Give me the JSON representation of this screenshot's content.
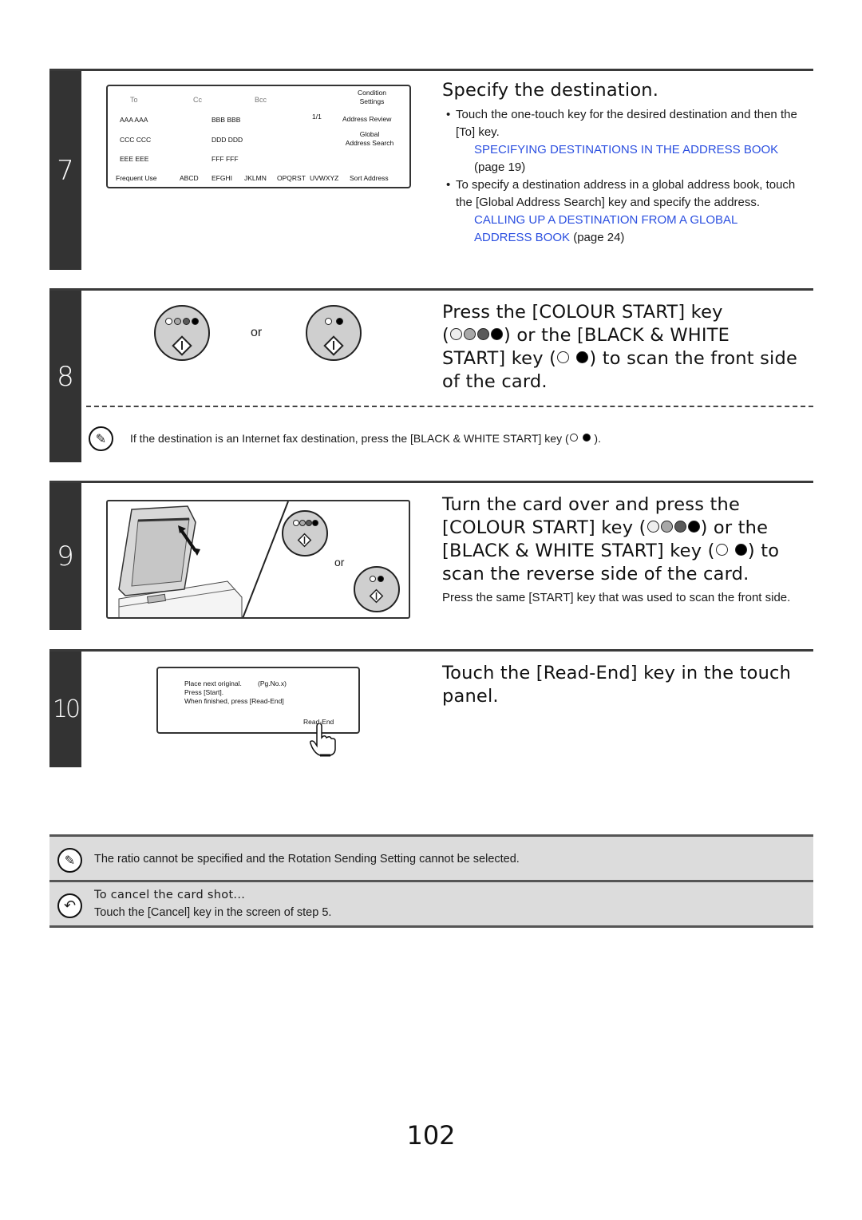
{
  "page_number": "102",
  "steps": [
    {
      "number": "7",
      "title": "Specify the destination.",
      "panel": {
        "headers": {
          "to": "To",
          "cc": "Cc",
          "bcc": "Bcc"
        },
        "condition_settings": "Condition Settings",
        "condition_line1": "Condition",
        "condition_line2": "Settings",
        "page_indicator": "1/1",
        "address_review": "Address Review",
        "global_line1": "Global",
        "global_line2": "Address Search",
        "entries": [
          "AAA AAA",
          "BBB BBB",
          "CCC CCC",
          "DDD DDD",
          "EEE EEE",
          "FFF FFF"
        ],
        "index_tabs": [
          "Frequent Use",
          "ABCD",
          "EFGHI",
          "JKLMN",
          "OPQRST",
          "UVWXYZ"
        ],
        "sort_address": "Sort Address"
      },
      "bullets": [
        {
          "text": "Touch the one-touch key for the desired destination and then the [To] key.",
          "link": "SPECIFYING DESTINATIONS IN THE ADDRESS BOOK",
          "page_ref": "(page 19)"
        },
        {
          "text": "To specify a destination address in a global address book, touch the [Global Address Search] key and specify the address.",
          "link_line1": "CALLING UP A DESTINATION FROM A GLOBAL",
          "link_line2": "ADDRESS BOOK",
          "page_ref": "(page 24)"
        }
      ]
    },
    {
      "number": "8",
      "title_line1": "Press the [COLOUR START] key",
      "title_line2_after": ") or the [BLACK & WHITE",
      "title_line3_before": "START] key (",
      "title_line3_after": ") to scan the front side",
      "title_line4": "of the card.",
      "or_label": "or",
      "note_before": "If the destination is an Internet fax destination, press the [BLACK & WHITE START] key (",
      "note_after": ")."
    },
    {
      "number": "9",
      "title_line1": "Turn the card over and press the",
      "title_line2_before": "[COLOUR START] key (",
      "title_line2_after": ") or the",
      "title_line3_before": "[BLACK & WHITE START] key (",
      "title_line3_after": ") to",
      "title_line4": "scan the reverse side of the card.",
      "or_label": "or",
      "body": "Press the same [START] key that was used to scan the front side."
    },
    {
      "number": "10",
      "title_line1": "Touch the [Read-End] key in the touch",
      "title_line2": "panel.",
      "panel": {
        "line1": "Place next original.",
        "page_hint": "(Pg.No.x)",
        "line2": "Press [Start].",
        "line3": "When finished, press [Read-End]",
        "button": "Read-End"
      }
    }
  ],
  "notes": {
    "info": "The ratio cannot be specified and the Rotation Sending Setting cannot be selected.",
    "cancel_title": "To cancel the card shot...",
    "cancel_text": "Touch the [Cancel] key in the screen of step 5."
  },
  "colors": {
    "step_bar": "#333333",
    "link": "#2b4fe0",
    "note_bg": "#dcdcdc",
    "key_gray": "#cfcfcf",
    "led_colours": [
      "#ffffff",
      "#a8a8a8",
      "#5a5a5a",
      "#000000"
    ]
  }
}
